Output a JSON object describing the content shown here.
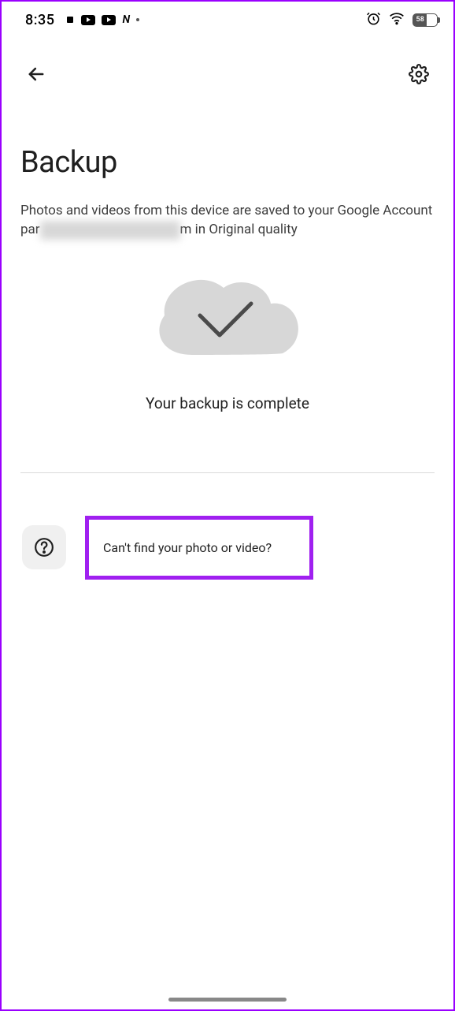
{
  "status_bar": {
    "time": "8:35",
    "battery_percent": "58",
    "battery_fill_width": "58%"
  },
  "page": {
    "title": "Backup",
    "subtitle_line1": "Photos and videos from this device are saved to your Google Account",
    "subtitle_prefix": "par",
    "subtitle_redacted": "redacted-email-address",
    "subtitle_suffix": "m in Original quality",
    "status_text": "Your backup is complete"
  },
  "help": {
    "link_text": "Can't find your photo or video?"
  }
}
